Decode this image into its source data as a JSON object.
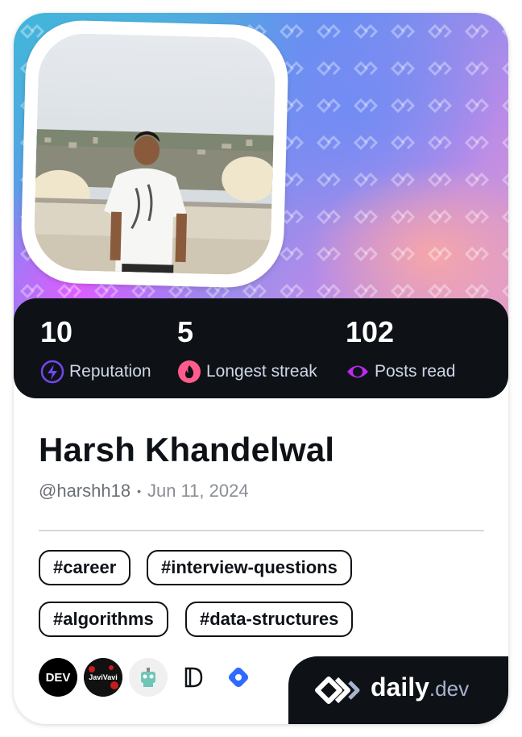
{
  "profile": {
    "name": "Harsh Khandelwal",
    "handle": "@harshh18",
    "separator": "•",
    "joined": "Jun 11, 2024",
    "avatar_alt": "Profile photo"
  },
  "stats": [
    {
      "value": "10",
      "label": "Reputation",
      "icon": "lightning-icon",
      "color": "#7147ed"
    },
    {
      "value": "5",
      "label": "Longest streak",
      "icon": "flame-icon",
      "color": "#ff5c8d"
    },
    {
      "value": "102",
      "label": "Posts read",
      "icon": "eye-icon",
      "color": "#c029f0"
    }
  ],
  "tags": [
    "#career",
    "#interview-questions",
    "#algorithms",
    "#data-structures"
  ],
  "sources": [
    {
      "name": "dev-source-icon",
      "label": "DEV",
      "bg": "#000000"
    },
    {
      "name": "javivavi-source-icon",
      "label": "JaviVavi",
      "bg": "#111111"
    },
    {
      "name": "robot-source-icon",
      "label": "",
      "bg": "#f0f0f0"
    },
    {
      "name": "d-logo-source-icon",
      "label": "",
      "bg": "#ffffff"
    },
    {
      "name": "blue-diamond-source-icon",
      "label": "",
      "bg": "#ffffff"
    }
  ],
  "brand": {
    "name": "daily",
    "tld": ".dev"
  },
  "colors": {
    "dark": "#0e1217",
    "accent_blue": "#2f6bff"
  }
}
